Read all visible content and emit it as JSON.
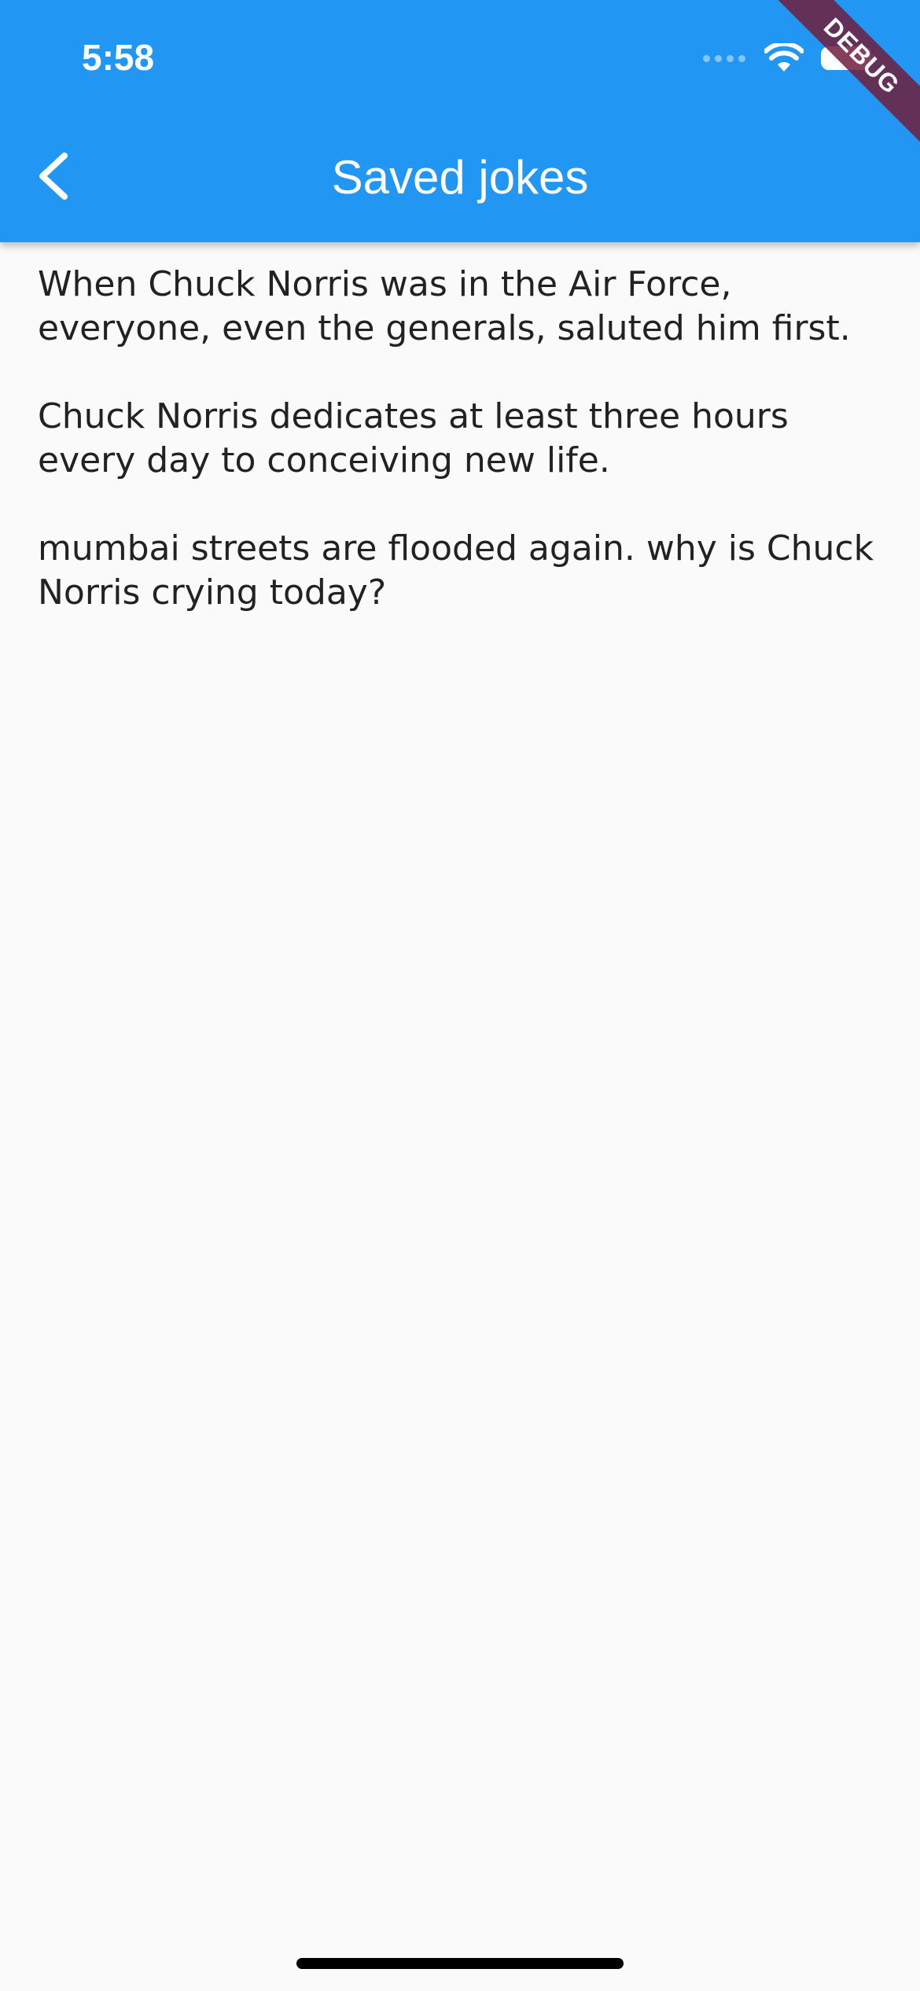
{
  "status_bar": {
    "time": "5:58"
  },
  "app_bar": {
    "title": "Saved jokes",
    "back_icon": "chevron-left-icon",
    "color": "#2196F3"
  },
  "debug_banner": {
    "label": "DEBUG"
  },
  "jokes": [
    "When Chuck Norris was in the Air Force, everyone, even the generals, saluted him first.",
    "Chuck Norris dedicates at least three hours every day to conceiving new life.",
    "mumbai streets are flooded again. why is Chuck Norris crying today?"
  ]
}
